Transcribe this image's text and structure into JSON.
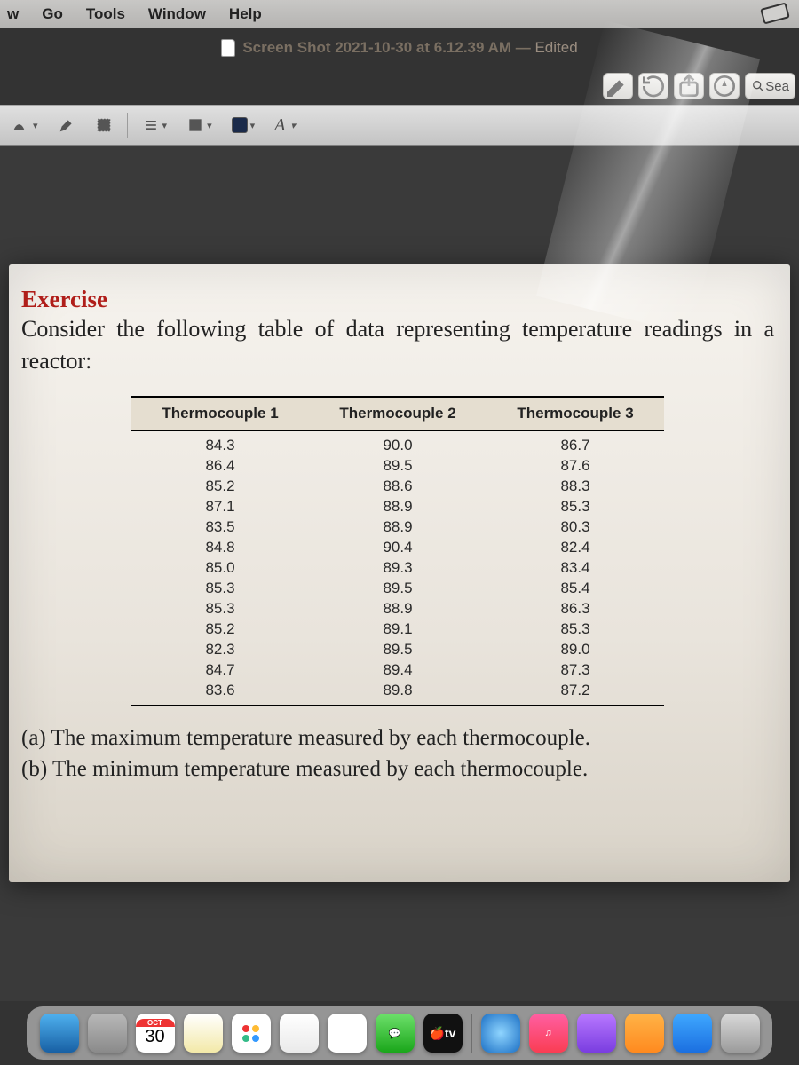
{
  "menubar": {
    "items": [
      "w",
      "Go",
      "Tools",
      "Window",
      "Help"
    ]
  },
  "titlebar": {
    "filename": "Screen Shot 2021-10-30 at 6.12.39 AM",
    "status": "Edited"
  },
  "toolbar_secondary": {
    "search_label": "Sea"
  },
  "document": {
    "heading": "Exercise",
    "intro": "Consider the following table of data representing temperature readings in a reactor:",
    "table": {
      "headers": [
        "Thermocouple 1",
        "Thermocouple 2",
        "Thermocouple 3"
      ],
      "rows": [
        [
          "84.3",
          "90.0",
          "86.7"
        ],
        [
          "86.4",
          "89.5",
          "87.6"
        ],
        [
          "85.2",
          "88.6",
          "88.3"
        ],
        [
          "87.1",
          "88.9",
          "85.3"
        ],
        [
          "83.5",
          "88.9",
          "80.3"
        ],
        [
          "84.8",
          "90.4",
          "82.4"
        ],
        [
          "85.0",
          "89.3",
          "83.4"
        ],
        [
          "85.3",
          "89.5",
          "85.4"
        ],
        [
          "85.3",
          "88.9",
          "86.3"
        ],
        [
          "85.2",
          "89.1",
          "85.3"
        ],
        [
          "82.3",
          "89.5",
          "89.0"
        ],
        [
          "84.7",
          "89.4",
          "87.3"
        ],
        [
          "83.6",
          "89.8",
          "87.2"
        ]
      ]
    },
    "questions": [
      "(a)  The maximum temperature measured by each thermocouple.",
      "(b)  The minimum temperature measured by each thermocouple."
    ]
  },
  "dock": {
    "calendar_month": "OCT",
    "calendar_day": "30",
    "tv_label": "tv",
    "items": [
      {
        "name": "finder",
        "bg": "linear-gradient(#4fb1ef,#1860a4)"
      },
      {
        "name": "launchpad",
        "bg": "linear-gradient(#b8b8b8,#8a8a8a)"
      },
      {
        "name": "calendar",
        "bg": "#fff"
      },
      {
        "name": "notes",
        "bg": "linear-gradient(#fff,#f3e9a8)"
      },
      {
        "name": "reminders",
        "bg": "#fff"
      },
      {
        "name": "freeform",
        "bg": "linear-gradient(#fff,#eaeaea)"
      },
      {
        "name": "photos",
        "bg": "#fff"
      },
      {
        "name": "messages",
        "bg": "linear-gradient(#6de06b,#1aa61a)"
      },
      {
        "name": "tv",
        "bg": "#111"
      },
      {
        "name": "safari",
        "bg": "radial-gradient(#8fd5ff,#1b6fc4)"
      },
      {
        "name": "music",
        "bg": "linear-gradient(#ff5fa2,#fa3d53)"
      },
      {
        "name": "podcasts",
        "bg": "linear-gradient(#b878ff,#7a3de0)"
      },
      {
        "name": "books",
        "bg": "linear-gradient(#ffb347,#ff8a1f)"
      },
      {
        "name": "appstore",
        "bg": "linear-gradient(#3fa8ff,#1b6fe0)"
      },
      {
        "name": "settings",
        "bg": "linear-gradient(#d9d9d9,#9b9b9b)"
      }
    ]
  },
  "chart_data": {
    "type": "table",
    "title": "Temperature readings in a reactor",
    "series": [
      {
        "name": "Thermocouple 1",
        "values": [
          84.3,
          86.4,
          85.2,
          87.1,
          83.5,
          84.8,
          85.0,
          85.3,
          85.3,
          85.2,
          82.3,
          84.7,
          83.6
        ]
      },
      {
        "name": "Thermocouple 2",
        "values": [
          90.0,
          89.5,
          88.6,
          88.9,
          88.9,
          90.4,
          89.3,
          89.5,
          88.9,
          89.1,
          89.5,
          89.4,
          89.8
        ]
      },
      {
        "name": "Thermocouple 3",
        "values": [
          86.7,
          87.6,
          88.3,
          85.3,
          80.3,
          82.4,
          83.4,
          85.4,
          86.3,
          85.3,
          89.0,
          87.3,
          87.2
        ]
      }
    ]
  }
}
